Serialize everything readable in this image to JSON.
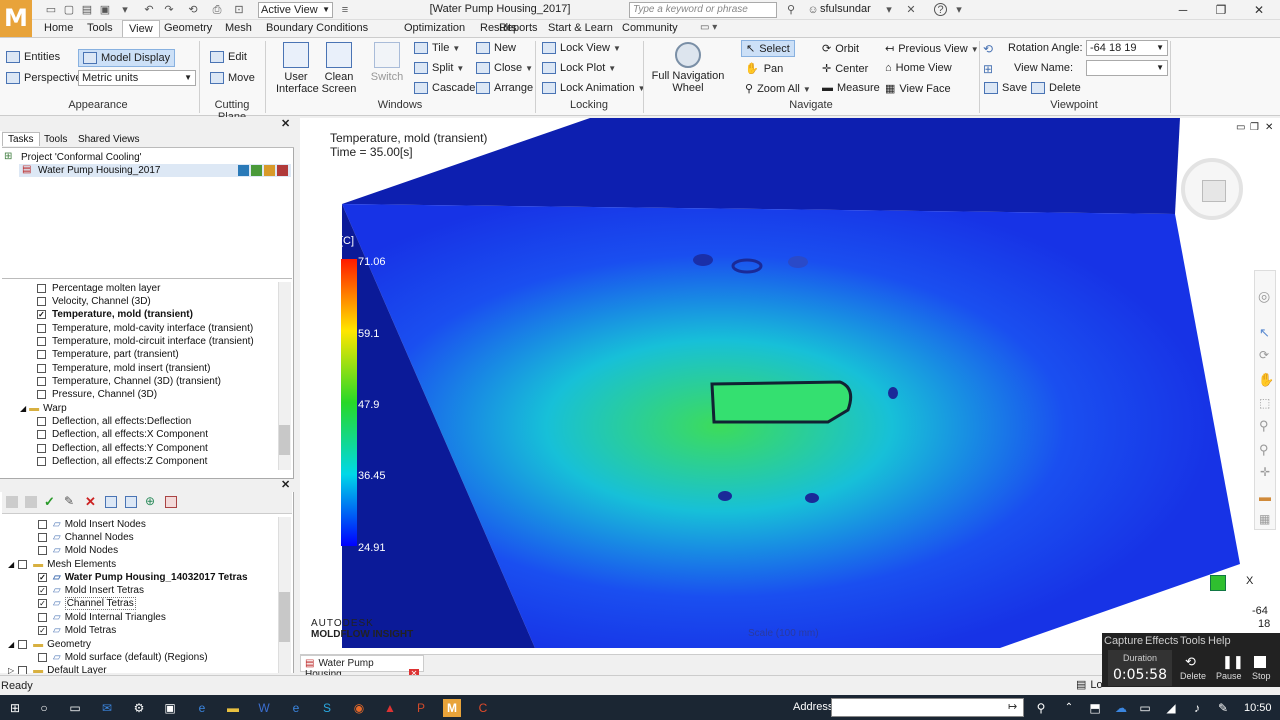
{
  "app": {
    "logo": "M",
    "window_title": "[Water Pump Housing_2017]",
    "active_view": "Active View"
  },
  "search": {
    "placeholder": "Type a keyword or phrase"
  },
  "user": {
    "name": "sfulsundar"
  },
  "menu": {
    "tabs": [
      "Home",
      "Tools",
      "View",
      "Geometry",
      "Mesh",
      "Boundary Conditions",
      "Optimization",
      "Results",
      "Reports",
      "Start & Learn",
      "Community"
    ],
    "active": "View"
  },
  "ribbon": {
    "appearance": {
      "label": "Appearance",
      "entities": "Entities",
      "model_display": "Model Display",
      "perspective": "Perspective",
      "units": "Metric units"
    },
    "cutting_plane": {
      "label": "Cutting Plane",
      "edit": "Edit",
      "move": "Move"
    },
    "windows": {
      "label": "Windows",
      "user_interface": "User Interface",
      "clean_screen": "Clean Screen",
      "switch": "Switch",
      "tile": "Tile",
      "split": "Split",
      "cascade": "Cascade",
      "new": "New",
      "close": "Close",
      "arrange": "Arrange"
    },
    "locking": {
      "label": "Locking",
      "lock_view": "Lock View",
      "lock_plot": "Lock Plot",
      "lock_animation": "Lock Animation"
    },
    "navigate": {
      "label": "Navigate",
      "full_nav_wheel": "Full Navigation Wheel",
      "select": "Select",
      "pan": "Pan",
      "zoom_all": "Zoom All",
      "orbit": "Orbit",
      "center": "Center",
      "measure": "Measure",
      "previous_view": "Previous View",
      "home_view": "Home View",
      "view_face": "View Face"
    },
    "viewpoint": {
      "label": "Viewpoint",
      "rotation_angle_label": "Rotation Angle:",
      "rotation_angle_value": "-64 18 19",
      "view_name_label": "View Name:",
      "save": "Save",
      "delete": "Delete"
    }
  },
  "tasks_panel": {
    "tabs": [
      "Tasks",
      "Tools",
      "Shared Views"
    ],
    "project": "Project 'Conformal Cooling'",
    "study": "Water Pump Housing_2017"
  },
  "results_list": [
    {
      "label": "Percentage molten layer",
      "checked": false,
      "bold": false
    },
    {
      "label": "Velocity, Channel (3D)",
      "checked": false,
      "bold": false
    },
    {
      "label": "Temperature, mold (transient)",
      "checked": true,
      "bold": true
    },
    {
      "label": "Temperature, mold-cavity interface (transient)",
      "checked": false,
      "bold": false
    },
    {
      "label": "Temperature, mold-circuit interface (transient)",
      "checked": false,
      "bold": false
    },
    {
      "label": "Temperature, part (transient)",
      "checked": false,
      "bold": false
    },
    {
      "label": "Temperature, mold insert (transient)",
      "checked": false,
      "bold": false
    },
    {
      "label": "Temperature, Channel (3D) (transient)",
      "checked": false,
      "bold": false
    },
    {
      "label": "Pressure, Channel (3D)",
      "checked": false,
      "bold": false
    }
  ],
  "warp_folder": "Warp",
  "warp_items": [
    "Deflection, all effects:Deflection",
    "Deflection, all effects:X Component",
    "Deflection, all effects:Y Component",
    "Deflection, all effects:Z Component"
  ],
  "layers": {
    "top_items": [
      {
        "label": "Mold Insert Nodes",
        "checked": false
      },
      {
        "label": "Channel Nodes",
        "checked": false
      },
      {
        "label": "Mold Nodes",
        "checked": false
      }
    ],
    "mesh_folder": "Mesh Elements",
    "mesh_items": [
      {
        "label": "Water Pump Housing_14032017 Tetras",
        "checked": true,
        "bold": true
      },
      {
        "label": "Mold Insert Tetras",
        "checked": true,
        "bold": false
      },
      {
        "label": "Channel Tetras",
        "checked": true,
        "bold": false
      },
      {
        "label": "Mold Internal Triangles",
        "checked": false,
        "bold": false
      },
      {
        "label": "Mold Tetras",
        "checked": true,
        "bold": false
      }
    ],
    "geometry_folder": "Geometry",
    "geometry_items": [
      {
        "label": "Mold surface (default) (Regions)",
        "checked": false
      }
    ],
    "default_layer": "Default Layer"
  },
  "viewport": {
    "result_title": "Temperature, mold (transient)",
    "time": "Time = 35.00[s]",
    "unit_label": "[C]",
    "legend_values": [
      "24.91",
      "36.45",
      "47.9",
      "59.1",
      "71.06"
    ],
    "brand_top": "AUTODESK",
    "brand_bottom": "MOLDFLOW INSIGHT",
    "scale": "Scale (100 mm)",
    "axis_x": "X",
    "axis_readout": [
      "-64",
      "18"
    ],
    "doc_tab": "Water Pump Housing..."
  },
  "status": {
    "text": "Ready",
    "log": "Lo"
  },
  "recorder": {
    "menu": [
      "Capture",
      "Effects",
      "Tools",
      "Help"
    ],
    "duration_label": "Duration",
    "duration": "0:05:58",
    "delete": "Delete",
    "pause": "Pause",
    "stop": "Stop"
  },
  "taskbar": {
    "address_label": "Address",
    "time": "10:50"
  },
  "colors": {
    "accent": "#e8a33a",
    "mold_blue": "#1733e6",
    "hot_green": "#3ddc5a",
    "taskbar": "#1b2633"
  }
}
